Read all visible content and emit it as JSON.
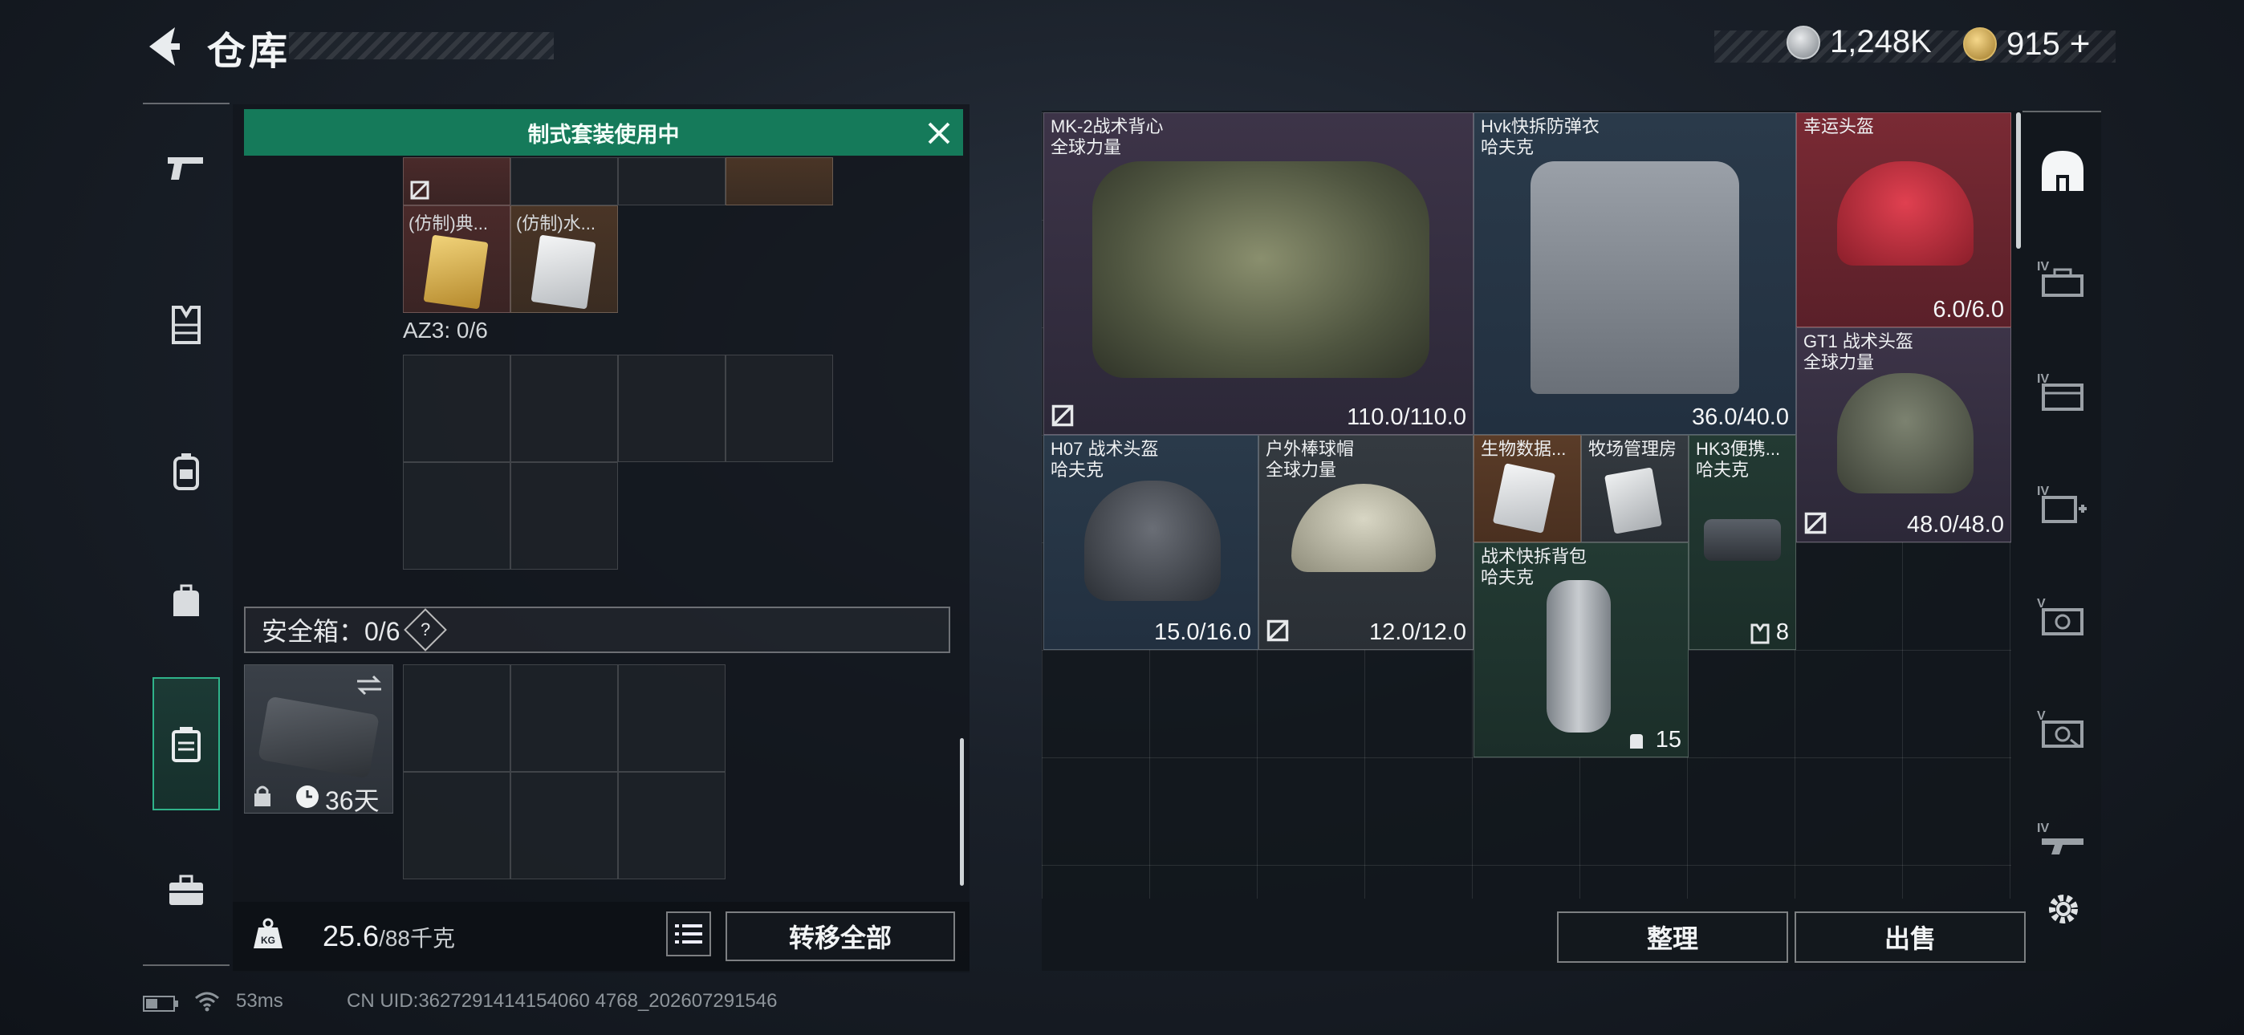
{
  "header": {
    "title": "仓库",
    "currency1": "1,248K",
    "currency2": "915",
    "currency2_plus": "+"
  },
  "left_nav": [
    {
      "icon": "pistol-icon"
    },
    {
      "icon": "armor-vest-icon"
    },
    {
      "icon": "chest-rig-icon"
    },
    {
      "icon": "backpack-icon"
    },
    {
      "icon": "safebox-icon"
    },
    {
      "icon": "briefcase-icon"
    }
  ],
  "loadout": {
    "banner": "制式套装使用中",
    "items_row2": [
      "(仿制)典...",
      "(仿制)水..."
    ],
    "az3_label": "AZ3: 0/6",
    "safebox_label": "安全箱：0/6",
    "safebox_help": "?",
    "safebox_days": "36天",
    "weight_value": "25.6",
    "weight_max": "/88千克",
    "transfer_all": "转移全部"
  },
  "stash_items": [
    {
      "name": "MK-2战术背心",
      "maker": "全球力量",
      "value": "110.0/110.0"
    },
    {
      "name": "Hvk快拆防弹衣",
      "maker": "哈夫克",
      "value": "36.0/40.0"
    },
    {
      "name": "幸运头盔",
      "maker": "",
      "value": "6.0/6.0"
    },
    {
      "name": "GT1 战术头盔",
      "maker": "全球力量",
      "value": "48.0/48.0"
    },
    {
      "name": "H07 战术头盔",
      "maker": "哈夫克",
      "value": "15.0/16.0"
    },
    {
      "name": "户外棒球帽",
      "maker": "全球力量",
      "value": "12.0/12.0"
    },
    {
      "name": "生物数据...",
      "maker": "",
      "value": ""
    },
    {
      "name": "牧场管理房",
      "maker": "",
      "value": ""
    },
    {
      "name": "HK3便携...",
      "maker": "哈夫克",
      "value": "8"
    },
    {
      "name": "战术快拆背包",
      "maker": "哈夫克",
      "value": "15"
    }
  ],
  "actions": {
    "organize": "整理",
    "sell": "出售"
  },
  "right_nav": [
    {
      "icon": "helmet-category-icon",
      "level": ""
    },
    {
      "icon": "armor-category-icon",
      "level": "IV"
    },
    {
      "icon": "rig-category-icon",
      "level": "IV"
    },
    {
      "icon": "medkit-category-icon",
      "level": "IV"
    },
    {
      "icon": "camera-category-icon",
      "level": "V"
    },
    {
      "icon": "camera-alt-category-icon",
      "level": "V"
    },
    {
      "icon": "weapon-category-icon",
      "level": "IV"
    }
  ],
  "status": {
    "ping": "53ms",
    "uid": "CN UID:3627291414154060 4768_202607291546"
  },
  "colors": {
    "accent_green": "#157a5a",
    "active_nav_border": "#2fb38a",
    "rarity_red": "#7a2a34",
    "rarity_purple": "#3d3448",
    "rarity_blue": "#2a3a4a"
  }
}
